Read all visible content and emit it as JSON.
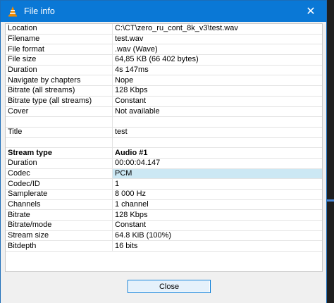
{
  "window": {
    "title": "File info"
  },
  "rows": [
    {
      "label": "Location",
      "value": "C:\\CT\\zero_ru_cont_8k_v3\\test.wav"
    },
    {
      "label": "Filename",
      "value": "test.wav"
    },
    {
      "label": "File format",
      "value": ".wav (Wave)"
    },
    {
      "label": "File size",
      "value": "64,85 KB (66 402 bytes)"
    },
    {
      "label": "Duration",
      "value": "4s 147ms"
    },
    {
      "label": "Navigate by chapters",
      "value": "Nope"
    },
    {
      "label": "Bitrate (all streams)",
      "value": "128 Kbps"
    },
    {
      "label": "Bitrate type (all streams)",
      "value": "Constant"
    },
    {
      "label": "Cover",
      "value": "Not available"
    },
    {
      "label": "",
      "value": ""
    },
    {
      "label": "Title",
      "value": "test"
    },
    {
      "label": "",
      "value": ""
    },
    {
      "label": "Stream type",
      "value": "Audio #1",
      "bold": true
    },
    {
      "label": "Duration",
      "value": "00:00:04.147"
    },
    {
      "label": "Codec",
      "value": "PCM",
      "highlight": true
    },
    {
      "label": "Codec/ID",
      "value": "1"
    },
    {
      "label": "Samplerate",
      "value": "8 000 Hz"
    },
    {
      "label": "Channels",
      "value": "1 channel"
    },
    {
      "label": "Bitrate",
      "value": "128 Kbps"
    },
    {
      "label": "Bitrate/mode",
      "value": "Constant"
    },
    {
      "label": "Stream size",
      "value": "64.8 KiB (100%)"
    },
    {
      "label": "Bitdepth",
      "value": "16 bits"
    }
  ],
  "footer": {
    "close_label": "Close"
  },
  "icons": {
    "app": "vlc-cone-icon",
    "close": "close-icon"
  },
  "colors": {
    "titlebar": "#0a78d6",
    "highlight": "#cce8f4",
    "button_border": "#0078d7"
  }
}
